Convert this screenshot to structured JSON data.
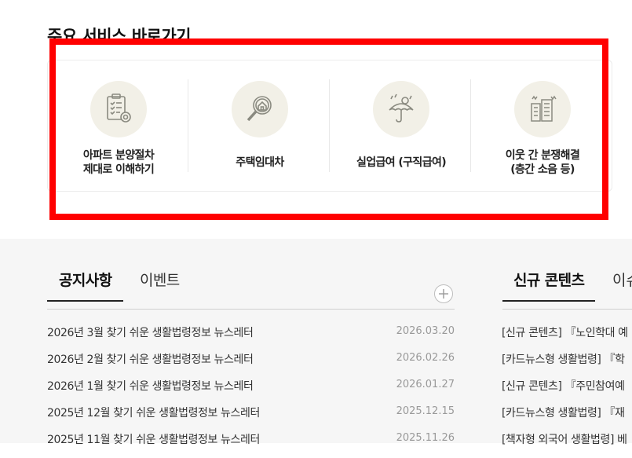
{
  "services": {
    "title": "주요 서비스 바로가기",
    "items": [
      {
        "label": "아파트 분양절차\n제대로 이해하기",
        "icon": "apartment-checklist-icon"
      },
      {
        "label": "주택임대차",
        "icon": "house-search-icon"
      },
      {
        "label": "실업급여 (구직급여)",
        "icon": "umbrella-coin-icon"
      },
      {
        "label": "이웃 간 분쟁해결\n(층간 소음 등)",
        "icon": "buildings-noise-icon"
      }
    ]
  },
  "notice": {
    "tabs": [
      "공지사항",
      "이벤트"
    ],
    "more_label": "+",
    "items": [
      {
        "title": "2026년 3월 찾기 쉬운 생활법령정보 뉴스레터",
        "date": "2026.03.20"
      },
      {
        "title": "2026년 2월 찾기 쉬운 생활법령정보 뉴스레터",
        "date": "2026.02.26"
      },
      {
        "title": "2026년 1월 찾기 쉬운 생활법령정보 뉴스레터",
        "date": "2026.01.27"
      },
      {
        "title": "2025년 12월 찾기 쉬운 생활법령정보 뉴스레터",
        "date": "2025.12.15"
      },
      {
        "title": "2025년 11월 찾기 쉬운 생활법령정보 뉴스레터",
        "date": "2025.11.26"
      }
    ]
  },
  "new_content": {
    "tabs": [
      "신규 콘텐츠",
      "이슈"
    ],
    "items": [
      "[신규 콘텐츠] 『노인학대 예",
      "[카드뉴스형 생활법령] 『학",
      "[신규 콘텐츠] 『주민참여예",
      "[카드뉴스형 생활법령] 『재",
      "[책자형 외국어 생활법령] 베"
    ]
  },
  "colors": {
    "highlight": "#ff0000",
    "icon_bg": "#f2f0e7",
    "section_bg": "#f6f6f6"
  }
}
